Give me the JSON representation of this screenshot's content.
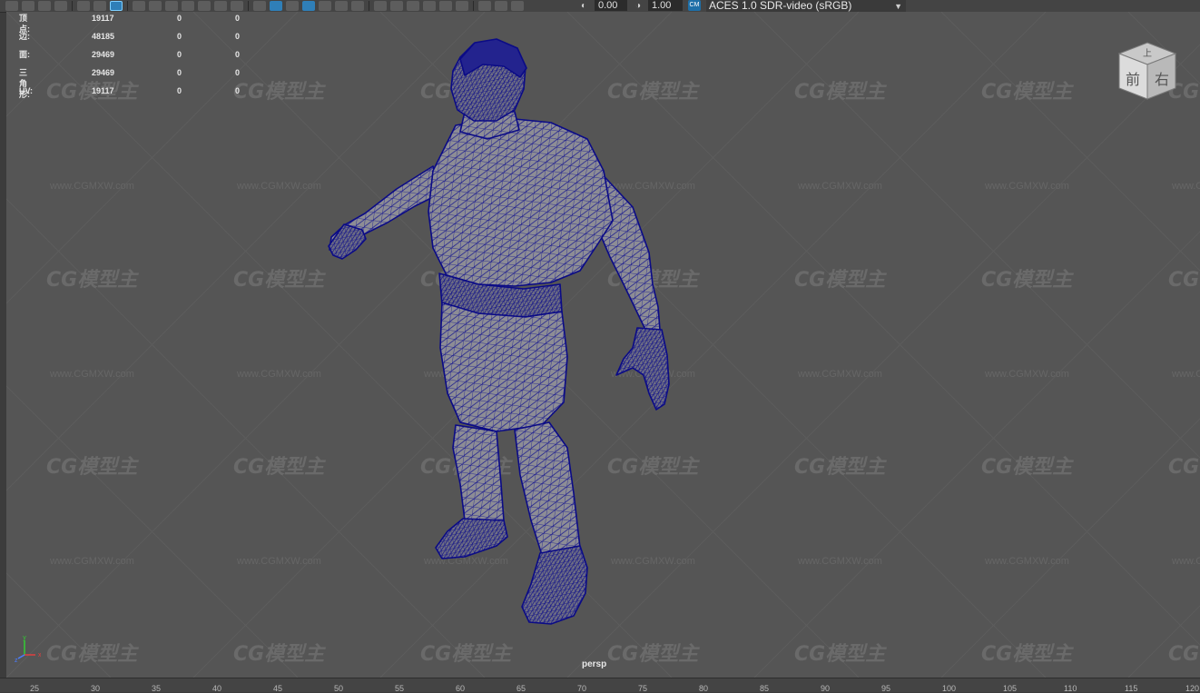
{
  "toolbar": {
    "exposure_value": "0.00",
    "gamma_value": "1.00",
    "colorspace_badge": "CM",
    "colorspace_label": "ACES 1.0 SDR-video (sRGB)"
  },
  "hud": {
    "rows": [
      {
        "label": "顶点:",
        "v1": "19117",
        "v2": "0",
        "v3": "0"
      },
      {
        "label": "边:",
        "v1": "48185",
        "v2": "0",
        "v3": "0"
      },
      {
        "label": "面:",
        "v1": "29469",
        "v2": "0",
        "v3": "0"
      },
      {
        "label": "三角形:",
        "v1": "29469",
        "v2": "0",
        "v3": "0"
      },
      {
        "label": "UV:",
        "v1": "19117",
        "v2": "0",
        "v3": "0"
      }
    ]
  },
  "viewcube": {
    "top": "上",
    "front": "前",
    "right": "右"
  },
  "camera_label": "persp",
  "axis_labels": {
    "x": "x",
    "y": "y",
    "z": "z"
  },
  "watermark": {
    "logo": "CG模型主",
    "url": "www.CGMXW.com"
  },
  "timeline_ticks": [
    "25",
    "30",
    "35",
    "40",
    "45",
    "50",
    "55",
    "60",
    "65",
    "70",
    "75",
    "80",
    "85",
    "90",
    "95",
    "100",
    "105",
    "110",
    "115",
    "120"
  ],
  "colors": {
    "wireframe": "#0b0b86",
    "viewport": "#555555",
    "accent": "#2f7fb8"
  }
}
